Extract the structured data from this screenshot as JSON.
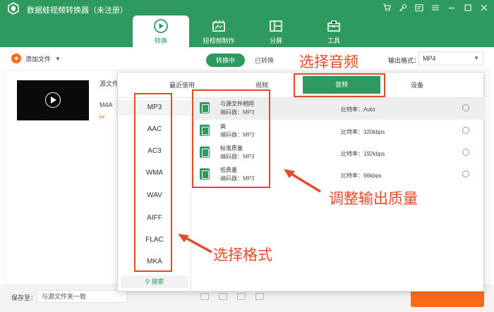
{
  "app": {
    "title": "数据蛙视频转换器（未注册）"
  },
  "nav": {
    "tabs": [
      {
        "label": "转换",
        "icon": "convert-icon",
        "active": true
      },
      {
        "label": "短视频制作",
        "icon": "movie-icon",
        "active": false
      },
      {
        "label": "分屏",
        "icon": "split-screen-icon",
        "active": false
      },
      {
        "label": "工具",
        "icon": "toolbox-icon",
        "active": false
      }
    ]
  },
  "toolbar": {
    "add_file": "添加文件",
    "converting": "转换中",
    "converted": "已转换",
    "output_format_label": "输出格式：",
    "output_format_value": "MP4"
  },
  "file": {
    "source_label": "源文件",
    "format": "M4A"
  },
  "popup": {
    "tabs": [
      "最近使用",
      "视频",
      "音频",
      "设备"
    ],
    "active_tab": "音频",
    "formats": [
      "MP3",
      "AAC",
      "AC3",
      "WMA",
      "WAV",
      "AIFF",
      "FLAC",
      "MKA"
    ],
    "selected_format": "MP3",
    "search": "搜索",
    "qualities": [
      {
        "name": "与源文件相同",
        "encoder": "编码器：MP3",
        "bitrate": "比特率：Auto"
      },
      {
        "name": "高",
        "encoder": "编码器：MP3",
        "bitrate": "比特率：320kbps"
      },
      {
        "name": "标准质量",
        "encoder": "编码器：MP3",
        "bitrate": "比特率：192kbps"
      },
      {
        "name": "低质量",
        "encoder": "编码器：MP3",
        "bitrate": "比特率：96kbps"
      }
    ]
  },
  "bottom": {
    "save_label": "保存至：",
    "save_value": "与源文件夹一致"
  },
  "annotations": {
    "select_audio": "选择音频",
    "adjust_quality": "调整输出质量",
    "select_format": "选择格式"
  },
  "colors": {
    "brand": "#2e9a5f",
    "accent": "#ff6a1a",
    "annotation": "#e24b2a"
  }
}
